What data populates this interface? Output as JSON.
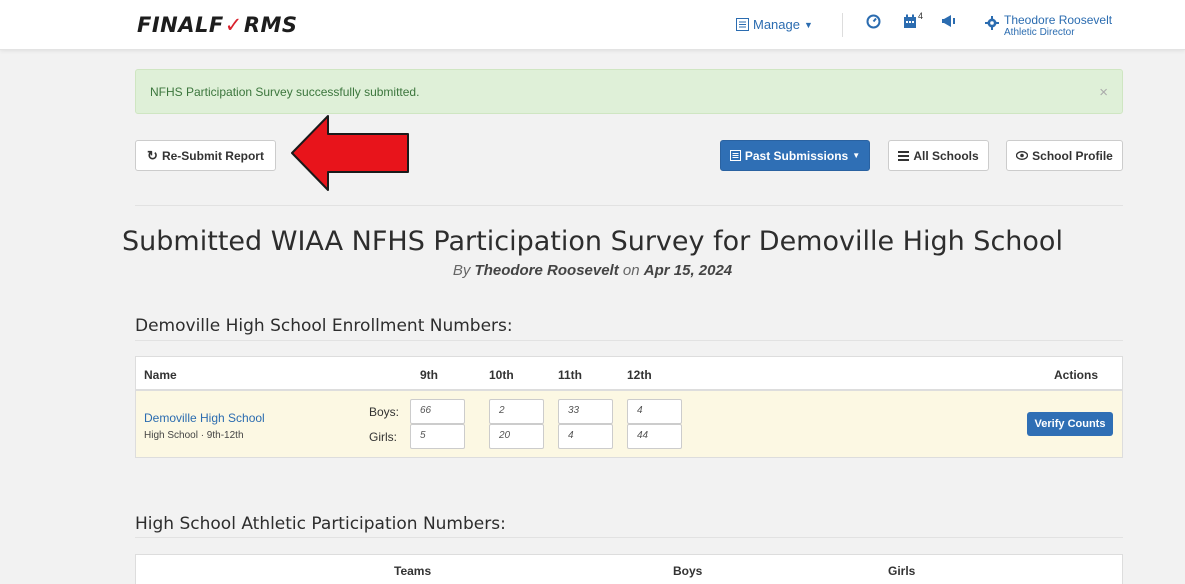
{
  "nav": {
    "logo_left": "FINALF",
    "logo_mark": "✓",
    "logo_right": "RMS",
    "manage_label": "Manage",
    "notification_count": "4",
    "user_name": "Theodore Roosevelt",
    "user_role": "Athletic Director"
  },
  "alert": {
    "message": "NFHS Participation Survey successfully submitted.",
    "close": "×"
  },
  "toolbar": {
    "resubmit_label": "Re-Submit Report",
    "past_submissions_label": "Past Submissions",
    "all_schools_label": "All Schools",
    "school_profile_label": "School Profile"
  },
  "page": {
    "title": "Submitted WIAA NFHS Participation Survey for Demoville High School",
    "by_prefix": "By ",
    "by_name": "Theodore Roosevelt",
    "by_on": " on ",
    "by_date": "Apr 15, 2024"
  },
  "enrollment": {
    "section_title": "Demoville High School Enrollment Numbers:",
    "headers": {
      "name": "Name",
      "g9": "9th",
      "g10": "10th",
      "g11": "11th",
      "g12": "12th",
      "actions": "Actions"
    },
    "school_name": "Demoville High School",
    "school_sub": "High School · 9th-12th",
    "boys_label": "Boys:",
    "girls_label": "Girls:",
    "boys": [
      "66",
      "2",
      "33",
      "4"
    ],
    "girls": [
      "5",
      "20",
      "4",
      "44"
    ],
    "verify_label": "Verify Counts"
  },
  "participation": {
    "section_title": "High School Athletic Participation Numbers:",
    "headers": {
      "teams": "Teams",
      "boys": "Boys",
      "girls": "Girls"
    }
  },
  "colors": {
    "primary": "#2f6fb5",
    "success_bg": "#dff0d8",
    "arrow_red": "#e8141b"
  }
}
